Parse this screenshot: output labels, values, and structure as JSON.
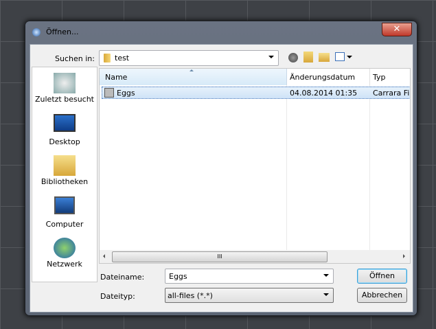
{
  "window": {
    "title": "Öffnen...",
    "close": "✕"
  },
  "lookin": {
    "label": "Suchen in:",
    "value": "test"
  },
  "toolbar": {
    "back": "back-icon",
    "up": "up-folder-icon",
    "new_folder": "new-folder-icon",
    "view": "view-menu-icon"
  },
  "places": [
    {
      "label": "Zuletzt besucht"
    },
    {
      "label": "Desktop"
    },
    {
      "label": "Bibliotheken"
    },
    {
      "label": "Computer"
    },
    {
      "label": "Netzwerk"
    }
  ],
  "columns": [
    "Name",
    "Änderungsdatum",
    "Typ"
  ],
  "files": [
    {
      "name": "Eggs",
      "date": "04.08.2014 01:35",
      "type": "Carrara Fil"
    }
  ],
  "scroll": {
    "grip": "III"
  },
  "filename": {
    "label": "Dateiname:",
    "value": "Eggs"
  },
  "filetype": {
    "label": "Dateityp:",
    "value": "all-files (*.*)"
  },
  "buttons": {
    "open": "Öffnen",
    "cancel": "Abbrechen"
  }
}
